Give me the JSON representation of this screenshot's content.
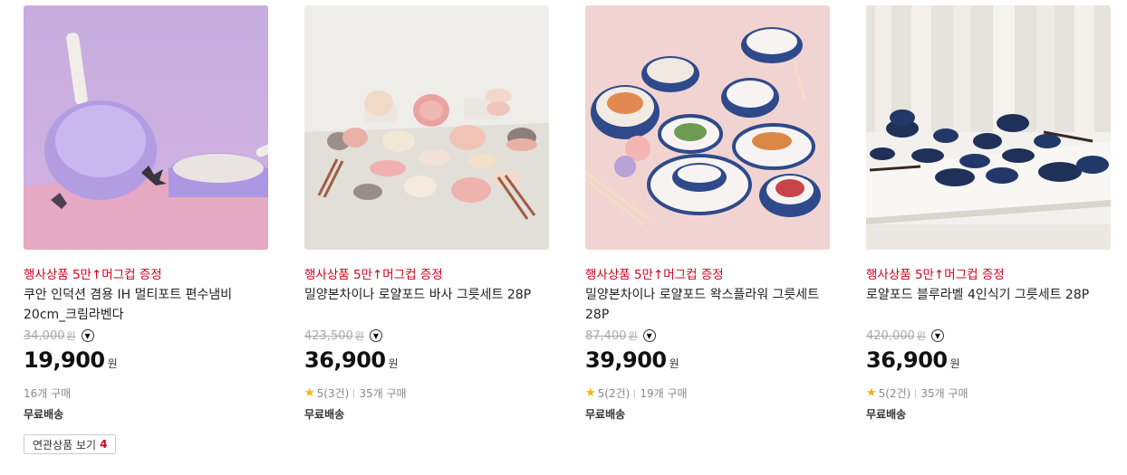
{
  "products": [
    {
      "promo": "행사상품 5만↑머그컵 증정",
      "title_line1": "쿠안 인덕션 겸용 IH 멀티포트 편수냄비",
      "title_line2": "20cm_크림라벤다",
      "original_price": "34,000",
      "original_unit": "원",
      "price": "19,900",
      "price_unit": "원",
      "rating": "",
      "reviews": "",
      "purchases": "16개 구매",
      "shipping": "무료배송",
      "colors": {
        "bg_top": "#c9b0e3",
        "bg_bottom": "#e9aec6",
        "pot": "#b8a4e6"
      }
    },
    {
      "promo": "행사상품 5만↑머그컵 증정",
      "title_line1": "밀양본차이나 로얄포드 바사 그릇세트 28P",
      "title_line2": "",
      "original_price": "423,500",
      "original_unit": "원",
      "price": "36,900",
      "price_unit": "원",
      "rating": "5",
      "reviews": "(3건)",
      "purchases": "35개 구매",
      "shipping": "무료배송",
      "colors": {
        "bg_top": "#f1f0ed",
        "bg_bottom": "#e3e0da"
      }
    },
    {
      "promo": "행사상품 5만↑머그컵 증정",
      "title_line1": "밀양본차이나 로얄포드 왁스플라워 그릇세트",
      "title_line2": "28P",
      "original_price": "87,400",
      "original_unit": "원",
      "price": "39,900",
      "price_unit": "원",
      "rating": "5",
      "reviews": "(2건)",
      "purchases": "19개 구매",
      "shipping": "무료배송",
      "colors": {
        "bg_top": "#f2d4d2",
        "bg_bottom": "#efcfcd"
      }
    },
    {
      "promo": "행사상품 5만↑머그컵 증정",
      "title_line1": "로얄포드 블루라벨 4인식기 그릇세트 28P",
      "title_line2": "",
      "original_price": "420,000",
      "original_unit": "원",
      "price": "36,900",
      "price_unit": "원",
      "rating": "5",
      "reviews": "(2건)",
      "purchases": "35개 구매",
      "shipping": "무료배송",
      "colors": {
        "bg_top": "#d8d3cc",
        "bg_bottom": "#f4f2ee"
      }
    }
  ],
  "related": {
    "label": "연관상품 보기",
    "count": "4"
  },
  "icons": {
    "toggle": "chevron-down-circle-icon",
    "star": "star-icon"
  },
  "accent": "#d0021b"
}
